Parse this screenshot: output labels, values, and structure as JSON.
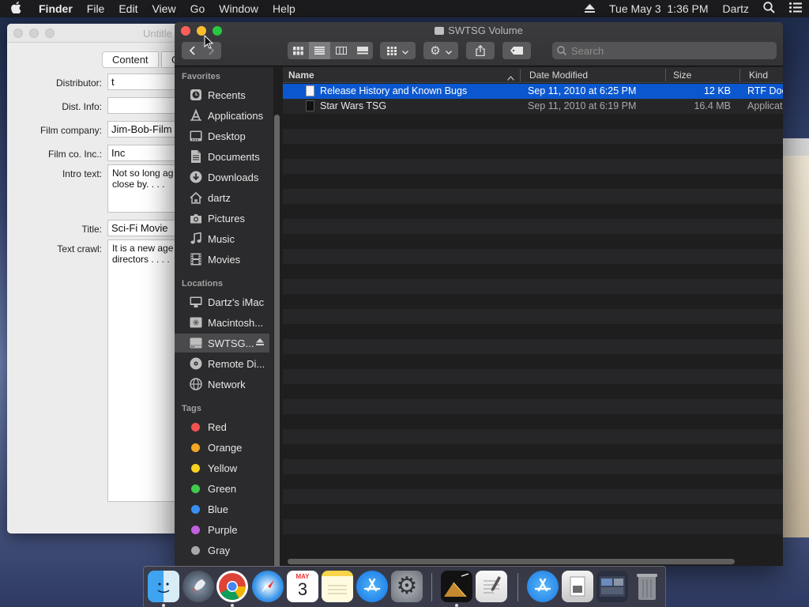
{
  "menubar": {
    "app": "Finder",
    "menus": [
      "File",
      "Edit",
      "View",
      "Go",
      "Window",
      "Help"
    ],
    "datetime": "Tue May 3  1:36 PM",
    "user": "Dartz"
  },
  "editor": {
    "title": "Untitle",
    "tabs": [
      "Content",
      "G"
    ],
    "labels": {
      "distributor": "Distributor:",
      "dist_info": "Dist. Info:",
      "film_company": "Film company:",
      "film_co_inc": "Film co. Inc.:",
      "intro_text": "Intro text:",
      "title": "Title:",
      "text_crawl": "Text crawl:"
    },
    "values": {
      "distributor": "t",
      "dist_info": "",
      "film_company": "Jim-Bob-Film",
      "film_co_inc": "Inc",
      "intro_text": "Not so long ag\nclose by. . . .",
      "title": "Sci-Fi Movie",
      "text_crawl": "It is a new age\ndirectors . . . ."
    }
  },
  "finder": {
    "window_title": "SWTSG Volume",
    "search_placeholder": "Search",
    "sidebar": {
      "favorites_header": "Favorites",
      "favorites": [
        {
          "label": "Recents",
          "icon": "clock-icon"
        },
        {
          "label": "Applications",
          "icon": "applications-icon"
        },
        {
          "label": "Desktop",
          "icon": "desktop-icon"
        },
        {
          "label": "Documents",
          "icon": "documents-icon"
        },
        {
          "label": "Downloads",
          "icon": "downloads-icon"
        },
        {
          "label": "dartz",
          "icon": "home-icon"
        },
        {
          "label": "Pictures",
          "icon": "camera-icon"
        },
        {
          "label": "Music",
          "icon": "music-note-icon"
        },
        {
          "label": "Movies",
          "icon": "film-icon"
        }
      ],
      "locations_header": "Locations",
      "locations": [
        {
          "label": "Dartz's iMac",
          "icon": "imac-icon"
        },
        {
          "label": "Macintosh...",
          "icon": "hard-drive-icon"
        },
        {
          "label": "SWTSG...",
          "icon": "volume-icon",
          "selected": true
        },
        {
          "label": "Remote Di...",
          "icon": "disc-icon"
        },
        {
          "label": "Network",
          "icon": "globe-icon"
        }
      ],
      "tags_header": "Tags",
      "tags": [
        {
          "label": "Red",
          "color": "#f0524f"
        },
        {
          "label": "Orange",
          "color": "#f5a623"
        },
        {
          "label": "Yellow",
          "color": "#f7d21e"
        },
        {
          "label": "Green",
          "color": "#3fcb4b"
        },
        {
          "label": "Blue",
          "color": "#3a8ff2"
        },
        {
          "label": "Purple",
          "color": "#c060e0"
        },
        {
          "label": "Gray",
          "color": "#a8a8a8"
        }
      ]
    },
    "columns": {
      "name": "Name",
      "date": "Date Modified",
      "size": "Size",
      "kind": "Kind"
    },
    "files": [
      {
        "name": "Release History and Known Bugs",
        "date": "Sep 11, 2010 at 6:25 PM",
        "size": "12 KB",
        "kind": "RTF Doc",
        "selected": true
      },
      {
        "name": "Star Wars TSG",
        "date": "Sep 11, 2010 at 6:19 PM",
        "size": "16.4 MB",
        "kind": "Applicat",
        "selected": false
      }
    ]
  },
  "dock": {
    "apps": [
      "Finder",
      "Launchpad",
      "Chrome",
      "Safari",
      "Calendar",
      "Notes",
      "App Store",
      "System Preferences",
      "Star Wars TSG",
      "TextEdit",
      "Applications",
      "Preview",
      "Documents",
      "Trash"
    ],
    "calendar_month": "MAY",
    "calendar_day": "3"
  },
  "colors": {
    "selection": "#0b57d0",
    "close": "#fc5f57",
    "minimize": "#fdbc2e",
    "zoom": "#28c840"
  }
}
